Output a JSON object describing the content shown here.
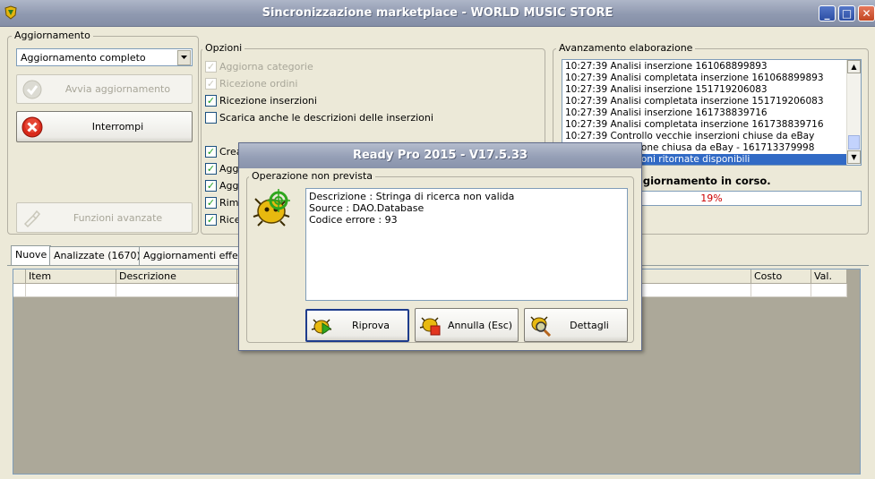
{
  "window": {
    "title": "Sincronizzazione marketplace - WORLD MUSIC STORE",
    "minimize": "_",
    "maximize": "□",
    "close": "✕",
    "icon": "app-logo-icon"
  },
  "aggiornamento": {
    "group_label": "Aggiornamento",
    "mode_value": "Aggiornamento completo",
    "start_button": "Avvia aggiornamento",
    "stop_button": "Interrompi",
    "advanced_button": "Funzioni avanzate"
  },
  "opzioni": {
    "group_label": "Opzioni",
    "items": [
      {
        "label": "Aggiorna categorie",
        "checked": true,
        "enabled": false
      },
      {
        "label": "Ricezione ordini",
        "checked": true,
        "enabled": false
      },
      {
        "label": "Ricezione inserzioni",
        "checked": true,
        "enabled": true
      },
      {
        "label": "Scarica anche le descrizioni delle inserzioni",
        "checked": false,
        "enabled": true
      },
      {
        "label": "Crea",
        "checked": true,
        "enabled": true
      },
      {
        "label": "Aggi",
        "checked": true,
        "enabled": true
      },
      {
        "label": "Aggi",
        "checked": true,
        "enabled": true
      },
      {
        "label": "Rimu",
        "checked": true,
        "enabled": true
      },
      {
        "label": "Rice",
        "checked": true,
        "enabled": true
      }
    ]
  },
  "avanzamento": {
    "group_label": "Avanzamento elaborazione",
    "log": [
      "10:27:39 Analisi inserzione 161068899893",
      "10:27:39 Analisi completata inserzione 161068899893",
      "10:27:39 Analisi inserzione 151719206083",
      "10:27:39 Analisi completata inserzione 151719206083",
      "10:27:39 Analisi inserzione 161738839716",
      "10:27:39 Analisi completata inserzione 161738839716",
      "10:27:39 Controllo vecchie inserzioni chiuse da eBay",
      "10:27:39 Inserzione chiusa da eBay - 161713379998",
      "10:27:39 Inserzioni ritornate disponibili"
    ],
    "selected_index": 8,
    "status": "Attendere. Aggiornamento in corso.",
    "progress_percent": 19,
    "progress_label": "19%"
  },
  "tabs": [
    {
      "label": "Nuove",
      "active": true
    },
    {
      "label": "Analizzate (1670)",
      "active": false
    },
    {
      "label": "Aggiornamenti effettuati",
      "active": false
    }
  ],
  "grid": {
    "columns": [
      "",
      "Item",
      "Descrizione",
      "",
      "Costo",
      "Val."
    ]
  },
  "dialog": {
    "title": "Ready Pro 2015 - V17.5.33",
    "group_label": "Operazione non prevista",
    "message_lines": [
      "Descrizione : Stringa di ricerca non valida",
      "Source : DAO.Database",
      "Codice errore : 93"
    ],
    "buttons": {
      "retry": "Riprova",
      "cancel": "Annulla (Esc)",
      "details": "Dettagli"
    }
  },
  "colors": {
    "titlebar": "#8f99b0",
    "selection": "#316ac5",
    "error_red": "#d92a1b",
    "progress_text": "#cc0000"
  }
}
